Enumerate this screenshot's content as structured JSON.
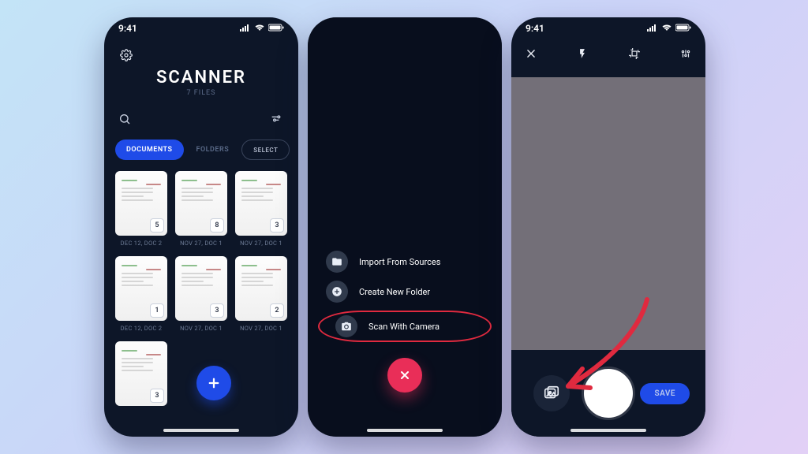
{
  "statusbar": {
    "time": "9:41"
  },
  "colors": {
    "accent": "#1f4be8",
    "danger": "#e92e58",
    "annotation": "#e02a3f"
  },
  "screen1": {
    "title": "SCANNER",
    "subtitle": "7 FILES",
    "tabs": {
      "documents": "DOCUMENTS",
      "folders": "FOLDERS"
    },
    "select_label": "SELECT",
    "docs": [
      {
        "count": "5",
        "caption": "DEC 12, DOC 2"
      },
      {
        "count": "8",
        "caption": "NOV 27, DOC 1"
      },
      {
        "count": "3",
        "caption": "NOV 27, DOC 1"
      },
      {
        "count": "1",
        "caption": "DEC 12, DOC 2"
      },
      {
        "count": "3",
        "caption": "NOV 27, DOC 1"
      },
      {
        "count": "2",
        "caption": "NOV 27, DOC 1"
      },
      {
        "count": "3",
        "caption": ""
      }
    ]
  },
  "screen2": {
    "actions": {
      "import": "Import From Sources",
      "newfolder": "Create New Folder",
      "scan": "Scan With Camera"
    }
  },
  "screen3": {
    "save_label": "SAVE"
  }
}
